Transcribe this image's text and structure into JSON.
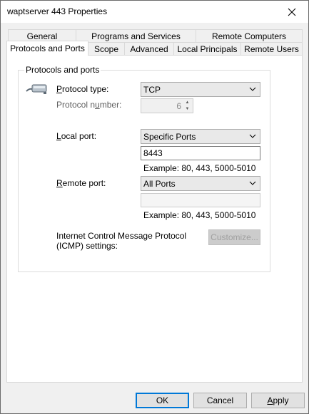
{
  "window": {
    "title": "waptserver 443 Properties"
  },
  "tabs": {
    "row1": [
      "General",
      "Programs and Services",
      "Remote Computers"
    ],
    "row2": [
      "Protocols and Ports",
      "Scope",
      "Advanced",
      "Local Principals",
      "Remote Users"
    ],
    "active": "Protocols and Ports"
  },
  "protocols": {
    "group_title": "Protocols and ports",
    "protocol_type_label_pre": "",
    "protocol_type_label_ul": "P",
    "protocol_type_label_post": "rotocol type:",
    "protocol_type_value": "TCP",
    "protocol_number_label_pre": "Protocol n",
    "protocol_number_label_ul": "u",
    "protocol_number_label_post": "mber:",
    "protocol_number_value": "6",
    "local_port_label_pre": "",
    "local_port_label_ul": "L",
    "local_port_label_post": "ocal port:",
    "local_port_select": "Specific Ports",
    "local_port_value": "8443",
    "local_example": "Example: 80, 443, 5000-5010",
    "remote_port_label_pre": "",
    "remote_port_label_ul": "R",
    "remote_port_label_post": "emote port:",
    "remote_port_select": "All Ports",
    "remote_port_value": "",
    "remote_example": "Example: 80, 443, 5000-5010",
    "icmp_line1": "Internet Control Message Protocol",
    "icmp_line2": "(ICMP) settings:",
    "customize_label": "Customize..."
  },
  "footer": {
    "ok_label": "OK",
    "cancel_label": "Cancel",
    "apply_pre": "",
    "apply_ul": "A",
    "apply_post": "pply"
  },
  "colors": {
    "accent": "#0078d7",
    "window_bg": "#f0f0f0",
    "panel_bg": "#ffffff"
  },
  "icons": {
    "close": "close-icon",
    "network": "network-cable-icon",
    "dropdown": "chevron-down-icon"
  }
}
